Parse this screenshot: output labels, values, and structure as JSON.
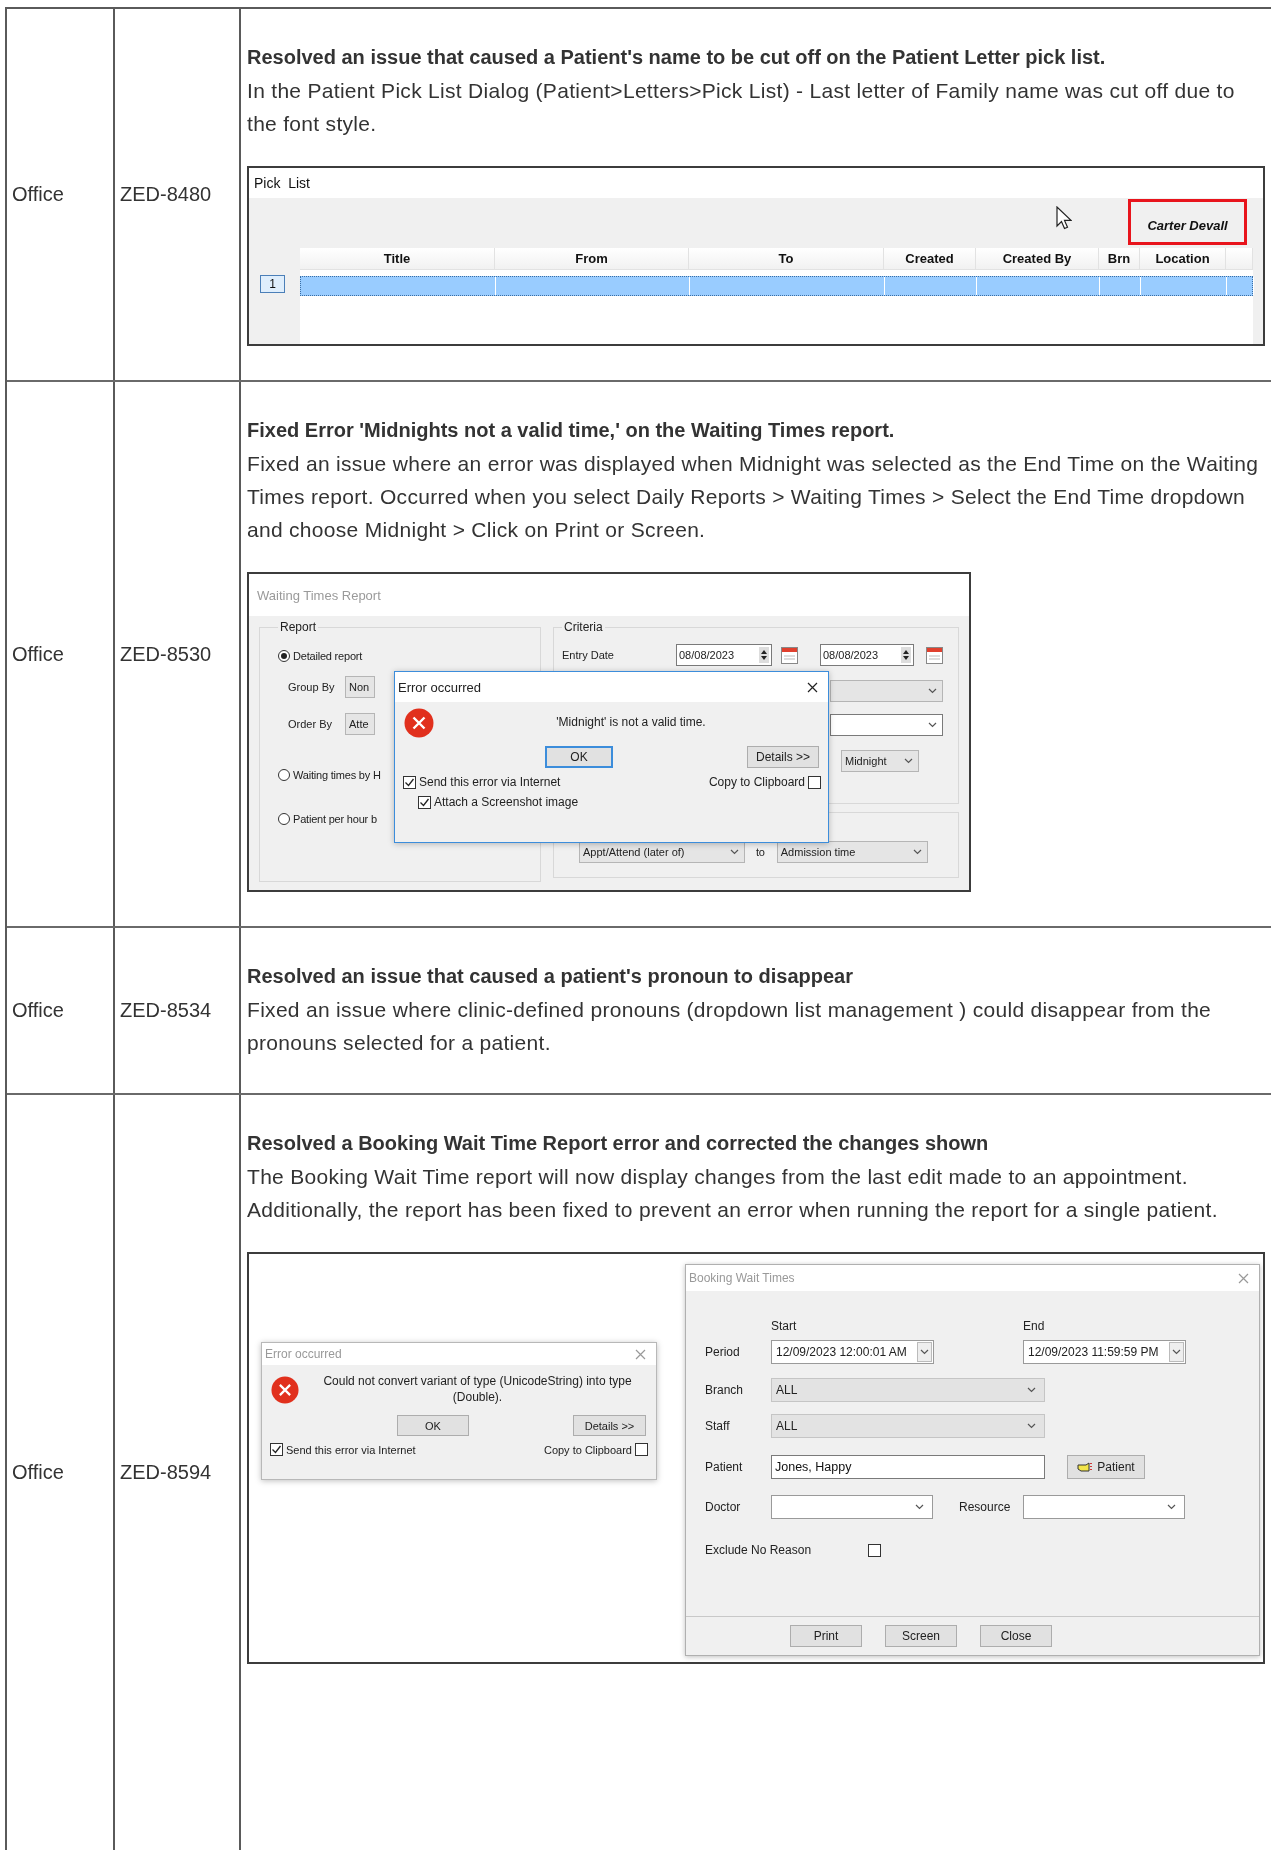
{
  "table": {
    "rows": [
      {
        "area": "Office",
        "ticket": "ZED-8480",
        "title": "Resolved an issue that caused a Patient's name to be cut off on the Patient Letter pick list.",
        "description": "In the Patient Pick List Dialog (Patient>Letters>Pick List) - Last letter of Family name was cut off due to the font style.",
        "screenshot": {
          "kind": "pick_list",
          "window_title": "Pick  List",
          "patient_name": "Carter Devall",
          "columns": [
            "Title",
            "From",
            "To",
            "Created",
            "Created By",
            "Brn",
            "Location"
          ],
          "rows": [
            {
              "number": "1",
              "selected": true
            }
          ]
        }
      },
      {
        "area": "Office",
        "ticket": "ZED-8530",
        "title": "Fixed Error 'Midnights not a valid time,' on the Waiting Times report.",
        "description": "Fixed an issue where an error was displayed when Midnight was selected as the End Time on the Waiting Times report. Occurred when you select Daily Reports > Waiting Times > Select the End Time dropdown and choose Midnight > Click on Print or Screen.",
        "screenshot": {
          "kind": "waiting_times",
          "window_title": "Waiting Times Report",
          "report_label": "Report",
          "report_options": [
            {
              "label": "Detailed report",
              "selected": true
            },
            {
              "label": "Waiting times by H",
              "selected": false
            },
            {
              "label": "Patient per hour b",
              "selected": false
            }
          ],
          "group_by_label": "Group By",
          "group_by_value": "Non",
          "order_by_label": "Order By",
          "order_by_value": "Atte",
          "criteria_label": "Criteria",
          "entry_date_label": "Entry Date",
          "entry_date_from": "08/08/2023",
          "entry_date_to": "08/08/2023",
          "end_time": "Midnight",
          "from_event": "Appt/Attend (later of)",
          "to_label": "to",
          "to_event": "Admission time",
          "error": {
            "title": "Error occurred",
            "focused": true,
            "message": "'Midnight' is not a valid time.",
            "ok": "OK",
            "details": "Details >>",
            "send": {
              "label": "Send this error via Internet",
              "checked": true
            },
            "attach": {
              "label": "Attach a Screenshot image",
              "checked": true
            },
            "copy": {
              "label": "Copy to Clipboard",
              "checked": false
            }
          }
        }
      },
      {
        "area": "Office",
        "ticket": "ZED-8534",
        "title": "Resolved an issue that caused a patient's pronoun to disappear",
        "description": "Fixed an issue where clinic-defined pronouns (dropdown list management ) could disappear from the pronouns selected for a patient."
      },
      {
        "area": "Office",
        "ticket": "ZED-8594",
        "title": "Resolved a Booking Wait Time Report error and corrected the changes shown",
        "description": "The Booking Wait Time report will now display changes from the last edit made to an appointment. Additionally, the report has been fixed to prevent an error when running the report for a single patient.",
        "screenshot": {
          "kind": "booking_wait_times",
          "error": {
            "title": "Error occurred",
            "focused": false,
            "message": "Could not convert variant of type (UnicodeString) into type (Double).",
            "ok": "OK",
            "details": "Details >>",
            "send": {
              "label": "Send this error via Internet",
              "checked": true
            },
            "copy": {
              "label": "Copy to Clipboard",
              "checked": false
            }
          },
          "form": {
            "window_title": "Booking Wait Times",
            "start_label": "Start",
            "end_label": "End",
            "period_label": "Period",
            "period_start": "12/09/2023 12:00:01 AM",
            "period_end": "12/09/2023 11:59:59 PM",
            "branch_label": "Branch",
            "branch": "ALL",
            "staff_label": "Staff",
            "staff": "ALL",
            "patient_label": "Patient",
            "patient": "Jones, Happy",
            "patient_button": "Patient",
            "doctor_label": "Doctor",
            "resource_label": "Resource",
            "exclude_label": "Exclude No Reason",
            "exclude_checked": false,
            "buttons": [
              "Print",
              "Screen",
              "Close"
            ]
          }
        }
      }
    ]
  }
}
